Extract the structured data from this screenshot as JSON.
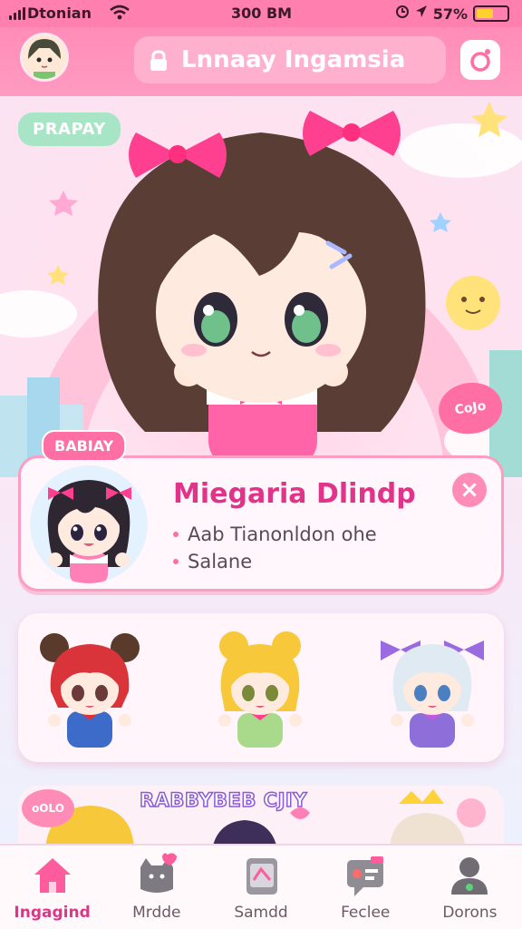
{
  "status_bar": {
    "carrier": "Dtonian",
    "time": "300 BM",
    "battery_percent": "57%",
    "battery_level": 0.57
  },
  "header": {
    "avatar_icon": "avatar-icon",
    "search_text": "Lnnaay Ingamsia",
    "lock_icon": "lock-icon",
    "camera_icon": "camera-icon"
  },
  "hero": {
    "tag": "PRAPAY",
    "heart_badge": "CoJo"
  },
  "profile": {
    "tag": "BABIAY",
    "name": "Miegaria Dlindp",
    "lines": [
      "Aab Tianonldon ohe",
      "Salane"
    ],
    "close_label": "×"
  },
  "friends": [
    {
      "name": "friend-red-bear-ears"
    },
    {
      "name": "friend-blonde-bun"
    },
    {
      "name": "friend-silver-purple-bow"
    }
  ],
  "strip": {
    "chip": "oOLO",
    "title": "RABBYBEB CJIY"
  },
  "nav": {
    "items": [
      {
        "label": "Ingagind",
        "icon": "home-icon",
        "active": true
      },
      {
        "label": "Mrdde",
        "icon": "cat-icon",
        "active": false
      },
      {
        "label": "Samdd",
        "icon": "card-icon",
        "active": false
      },
      {
        "label": "Feclee",
        "icon": "chat-icon",
        "active": false
      },
      {
        "label": "Dorons",
        "icon": "profile-icon",
        "active": false
      }
    ]
  },
  "colors": {
    "primary_pink": "#ff7fae",
    "accent_magenta": "#e0338a",
    "mint": "#a8e5c6"
  }
}
